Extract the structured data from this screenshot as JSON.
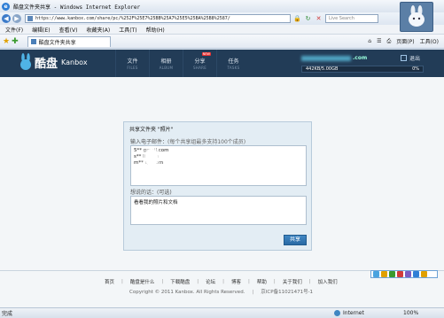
{
  "browser": {
    "window_title": "酷盘文件夹共享 - Windows Internet Explorer",
    "url": "https://www.kanbox.com/share/pc/%252F%25E7%25BB%25A7%25E5%25BA%25B8%2587/",
    "search_placeholder": "Live Search",
    "menu": [
      "文件(F)",
      "编辑(E)",
      "查看(V)",
      "收藏夹(A)",
      "工具(T)",
      "帮助(H)"
    ],
    "tab_title": "酷盘文件夹共享",
    "tools": [
      "页面(P)",
      "工具(O)"
    ],
    "status_left": "完成",
    "status_zone": "Internet",
    "zoom": "100%"
  },
  "site": {
    "logo_cn": "酷盘",
    "logo_en": "Kanbox",
    "nav": [
      {
        "cn": "文件",
        "en": "FILES"
      },
      {
        "cn": "相册",
        "en": "ALBUM"
      },
      {
        "cn": "分享",
        "en": "SHARE",
        "badge": "NEW"
      },
      {
        "cn": "任务",
        "en": "TASKS"
      }
    ],
    "user_email_suffix": ".com",
    "quota_used": "442KB/5.00GB",
    "quota_percent": "0%",
    "quota_fraction": 0.0,
    "logout": "退出"
  },
  "share_dialog": {
    "title": "共享文件夹 \"照片\"",
    "email_label": "输入电子邮件：",
    "email_hint": "(每个共享组最多支持100个成员)",
    "emails": [
      "5** gmail.com",
      "s** live.cn",
      "m** qq.com"
    ],
    "message_label": "想说的话：(可选)",
    "message": "看看我的照片和文档",
    "share_button": "共享"
  },
  "footer": {
    "links": [
      "首页",
      "酷盘是什么",
      "下载酷盘",
      "论坛",
      "博客",
      "帮助",
      "关于我们",
      "加入我们"
    ],
    "copyright": "Copyright © 2011 Kanbox. All Rights Reserved.",
    "icp": "京ICP备11021471号-1"
  }
}
